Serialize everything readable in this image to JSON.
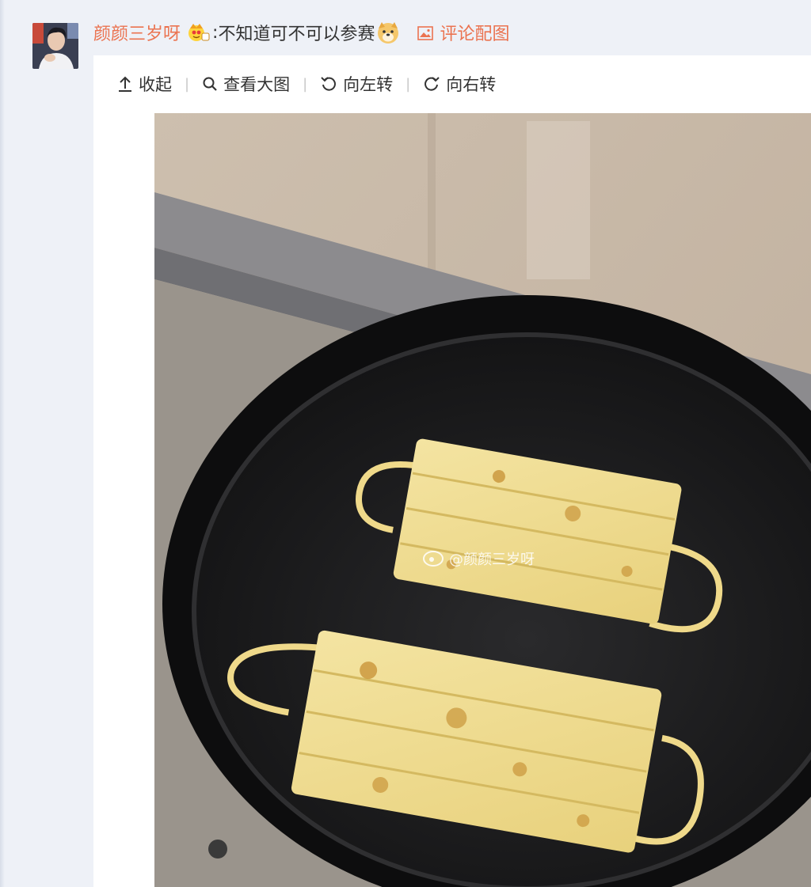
{
  "comment": {
    "username": "颜颜三岁呀",
    "colon": ":",
    "text": "不知道可不可以参赛",
    "attachment_label": "评论配图"
  },
  "toolbar": {
    "collapse_label": "收起",
    "view_large_label": "查看大图",
    "rotate_left_label": "向左转",
    "rotate_right_label": "向右转",
    "separator": "|"
  },
  "image": {
    "watermark": "@颜颜三岁呀"
  },
  "icons": {
    "badge": "crown-badge-icon",
    "emoji": "doge-emoji-icon",
    "attachment": "picture-icon",
    "collapse": "arrow-up-icon",
    "view_large": "search-icon",
    "rotate_left": "rotate-left-icon",
    "rotate_right": "rotate-right-icon"
  },
  "colors": {
    "accent": "#eb7350",
    "text": "#333333",
    "page_bg": "#eef1f7"
  }
}
